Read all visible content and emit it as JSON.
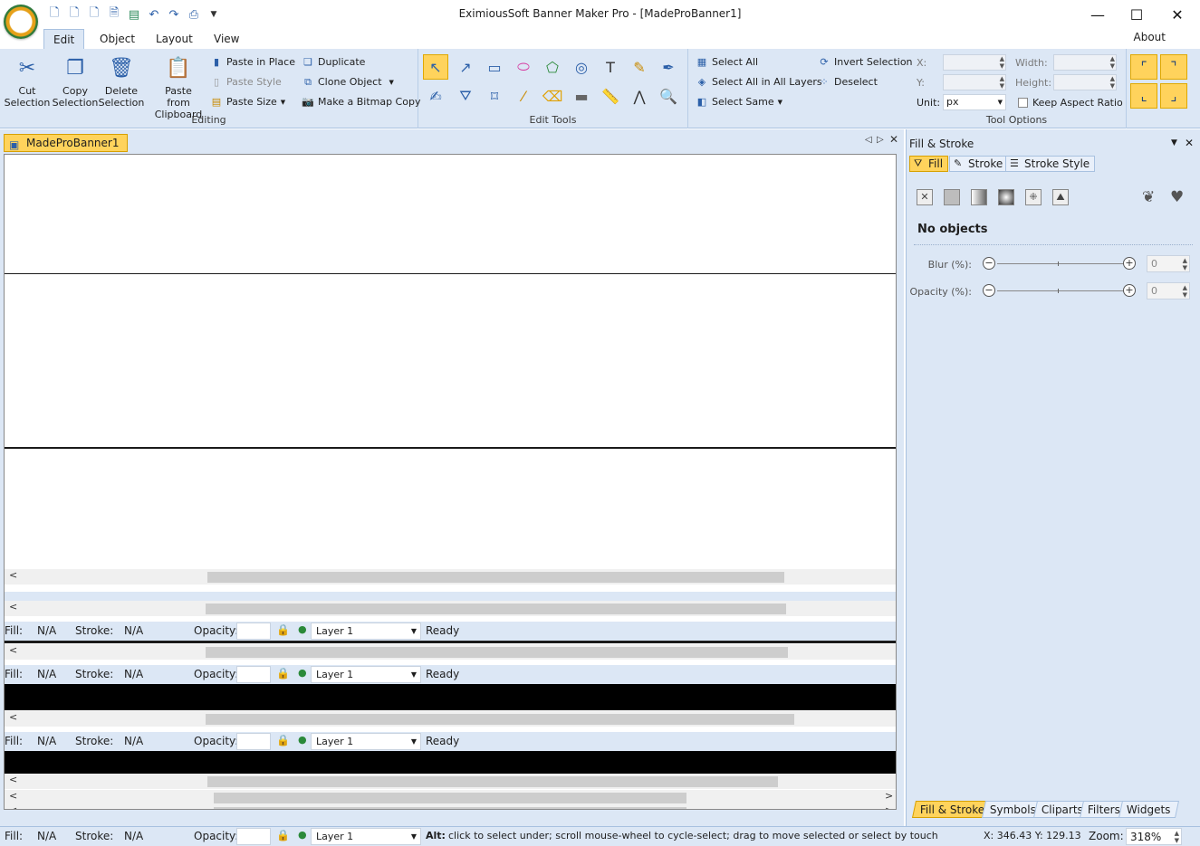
{
  "window": {
    "title": "EximiousSoft Banner Maker Pro - [MadeProBanner1]",
    "minimize": "—",
    "maximize": "☐",
    "close": "✕"
  },
  "ribbon_tabs": [
    "Edit",
    "Object",
    "Layout",
    "View"
  ],
  "about": "About",
  "editing": {
    "label": "Editing",
    "cut": "Cut Selection",
    "cut1": "Cut",
    "cut2": "Selection",
    "copy1": "Copy",
    "copy2": "Selection",
    "delete1": "Delete",
    "delete2": "Selection",
    "paste1": "Paste from",
    "paste2": "Clipboard",
    "paste_in_place": "Paste in Place",
    "paste_style": "Paste Style",
    "paste_size": "Paste Size",
    "duplicate": "Duplicate",
    "clone_object": "Clone Object",
    "make_bitmap": "Make a Bitmap Copy"
  },
  "edit_tools": {
    "label": "Edit Tools"
  },
  "selection": {
    "select_all": "Select All",
    "select_all_layers": "Select All in All Layers",
    "select_same": "Select Same",
    "invert": "Invert Selection",
    "deselect": "Deselect"
  },
  "tool_options": {
    "label": "Tool Options",
    "x": "X:",
    "y": "Y:",
    "width": "Width:",
    "height": "Height:",
    "unit_label": "Unit:",
    "unit_value": "px",
    "keep_aspect": "Keep Aspect Ratio"
  },
  "document": {
    "tab": "MadeProBanner1"
  },
  "status_strip": {
    "fill": "Fill:",
    "fill_val": "N/A",
    "stroke": "Stroke:",
    "stroke_val": "N/A",
    "opacity": "Opacity:",
    "layer": "Layer 1",
    "ready": "Ready"
  },
  "panel": {
    "title": "Fill & Stroke",
    "tab_fill": "Fill",
    "tab_stroke": "Stroke",
    "tab_stroke_style": "Stroke Style",
    "no_objects": "No objects",
    "blur_label": "Blur (%):",
    "blur_value": "0",
    "opacity_label": "Opacity (%):",
    "opacity_value": "0",
    "bottom_tabs": [
      "Fill & Stroke",
      "Symbols",
      "Cliparts",
      "Filters",
      "Widgets"
    ]
  },
  "statusbar": {
    "fill": "Fill:",
    "fill_val": "N/A",
    "stroke": "Stroke:",
    "stroke_val": "N/A",
    "opacity": "Opacity:",
    "layer": "Layer 1",
    "hint_bold": "Alt:",
    "hint": "click to select under; scroll mouse-wheel to cycle-select; drag to move selected or select by touch",
    "coords": "X:  346.43 Y:  129.13",
    "zoom_label": "Zoom:",
    "zoom_value": "318%"
  }
}
